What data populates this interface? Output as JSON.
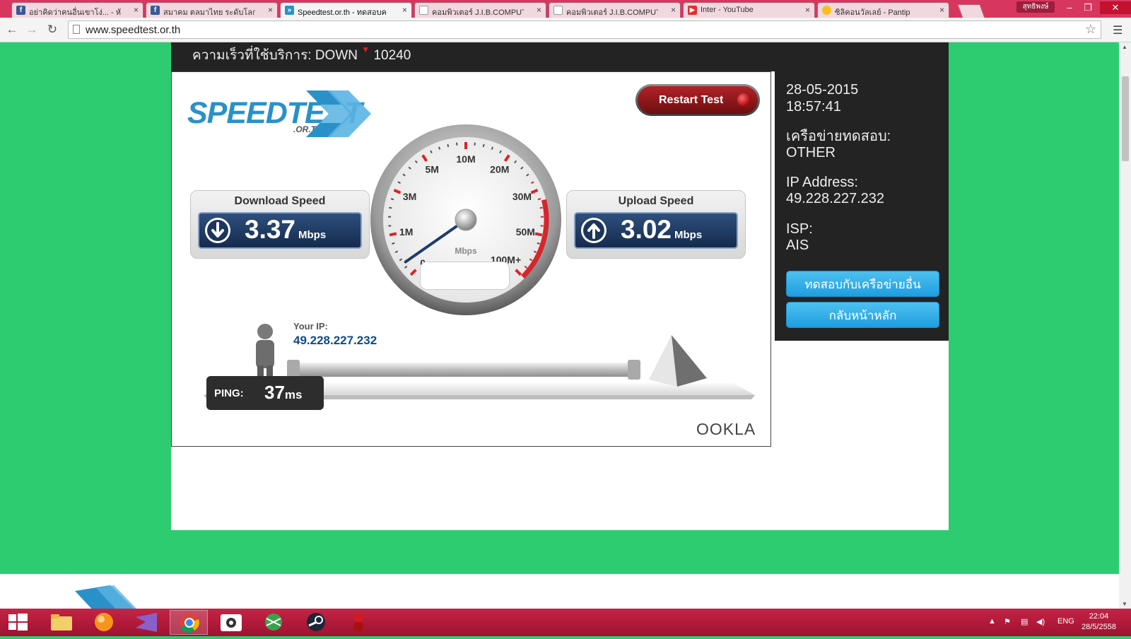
{
  "browser": {
    "tabs": [
      {
        "title": "อย่าคิดว่าคนอื่นเขาโง่... - หักดิ",
        "favicon": "facebook-icon",
        "active": false
      },
      {
        "title": "สมาคม ตลมาไทย ระดับโลก - ",
        "favicon": "facebook-icon",
        "active": false
      },
      {
        "title": "Speedtest.or.th - ทดสอบค",
        "favicon": "speedtest-icon",
        "active": true
      },
      {
        "title": "คอมพิวเตอร์ J.I.B.COMPUTE",
        "favicon": "page-icon",
        "active": false
      },
      {
        "title": "คอมพิวเตอร์ J.I.B.COMPUTE",
        "favicon": "page-icon",
        "active": false
      },
      {
        "title": "Inter - YouTube",
        "favicon": "youtube-icon",
        "active": false
      },
      {
        "title": "ซิลิคอนวัลเลย์ - Pantip",
        "favicon": "pantip-icon",
        "active": false
      }
    ],
    "tab_close": "×",
    "user": "สุทธิพงษ์",
    "url": "www.speedtest.or.th"
  },
  "info_bar": {
    "label": "ความเร็วที่ใช้บริการ: DOWN",
    "arrow": "▼",
    "value": "10240"
  },
  "speedtest": {
    "restart_label": "Restart Test",
    "logo_word": "SPEEDTEST",
    "logo_sub": ".OR.TH",
    "download": {
      "title": "Download Speed",
      "value": "3.37",
      "unit": "Mbps"
    },
    "upload": {
      "title": "Upload Speed",
      "value": "3.02",
      "unit": "Mbps"
    },
    "gauge": {
      "unit_label": "Mbps",
      "ticks": [
        "0",
        "1M",
        "3M",
        "5M",
        "10M",
        "20M",
        "30M",
        "50M",
        "100M+"
      ],
      "needle_value_mbps": 0.3
    },
    "your_ip_label": "Your IP:",
    "your_ip": "49.228.227.232",
    "ping_label": "PING:",
    "ping_value": "37",
    "ping_unit": "ms",
    "brand": "OOKLA"
  },
  "side_panel": {
    "date": "28-05-2015",
    "time": "18:57:41",
    "network_label": "เครือข่ายทดสอบ:",
    "network": "OTHER",
    "ip_label": "IP Address:",
    "ip": "49.228.227.232",
    "isp_label": "ISP:",
    "isp": "AIS",
    "btn_other_network": "ทดสอบกับเครือข่ายอื่น",
    "btn_home": "กลับหน้าหลัก"
  },
  "taskbar": {
    "tray_lang": "ENG",
    "clock_time": "22:04",
    "clock_date": "28/5/2558"
  },
  "colors": {
    "page_bg": "#2ecc71",
    "accent_blue": "#2a91c8",
    "restart_red": "#b02327",
    "taskbar": "#b81b3c"
  }
}
